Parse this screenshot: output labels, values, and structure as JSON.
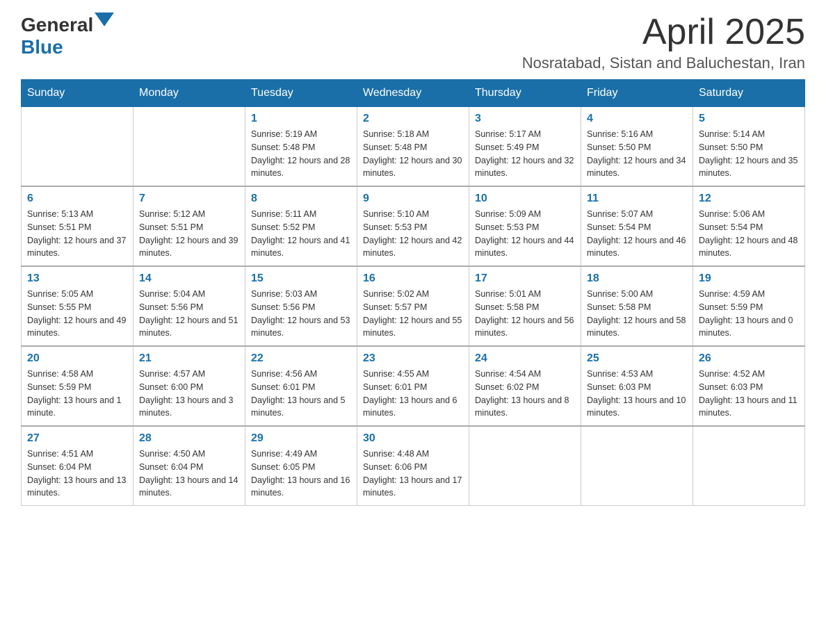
{
  "header": {
    "logo_general": "General",
    "logo_blue": "Blue",
    "month_year": "April 2025",
    "location": "Nosratabad, Sistan and Baluchestan, Iran"
  },
  "days_of_week": [
    "Sunday",
    "Monday",
    "Tuesday",
    "Wednesday",
    "Thursday",
    "Friday",
    "Saturday"
  ],
  "weeks": [
    [
      {
        "day": "",
        "sunrise": "",
        "sunset": "",
        "daylight": ""
      },
      {
        "day": "",
        "sunrise": "",
        "sunset": "",
        "daylight": ""
      },
      {
        "day": "1",
        "sunrise": "Sunrise: 5:19 AM",
        "sunset": "Sunset: 5:48 PM",
        "daylight": "Daylight: 12 hours and 28 minutes."
      },
      {
        "day": "2",
        "sunrise": "Sunrise: 5:18 AM",
        "sunset": "Sunset: 5:48 PM",
        "daylight": "Daylight: 12 hours and 30 minutes."
      },
      {
        "day": "3",
        "sunrise": "Sunrise: 5:17 AM",
        "sunset": "Sunset: 5:49 PM",
        "daylight": "Daylight: 12 hours and 32 minutes."
      },
      {
        "day": "4",
        "sunrise": "Sunrise: 5:16 AM",
        "sunset": "Sunset: 5:50 PM",
        "daylight": "Daylight: 12 hours and 34 minutes."
      },
      {
        "day": "5",
        "sunrise": "Sunrise: 5:14 AM",
        "sunset": "Sunset: 5:50 PM",
        "daylight": "Daylight: 12 hours and 35 minutes."
      }
    ],
    [
      {
        "day": "6",
        "sunrise": "Sunrise: 5:13 AM",
        "sunset": "Sunset: 5:51 PM",
        "daylight": "Daylight: 12 hours and 37 minutes."
      },
      {
        "day": "7",
        "sunrise": "Sunrise: 5:12 AM",
        "sunset": "Sunset: 5:51 PM",
        "daylight": "Daylight: 12 hours and 39 minutes."
      },
      {
        "day": "8",
        "sunrise": "Sunrise: 5:11 AM",
        "sunset": "Sunset: 5:52 PM",
        "daylight": "Daylight: 12 hours and 41 minutes."
      },
      {
        "day": "9",
        "sunrise": "Sunrise: 5:10 AM",
        "sunset": "Sunset: 5:53 PM",
        "daylight": "Daylight: 12 hours and 42 minutes."
      },
      {
        "day": "10",
        "sunrise": "Sunrise: 5:09 AM",
        "sunset": "Sunset: 5:53 PM",
        "daylight": "Daylight: 12 hours and 44 minutes."
      },
      {
        "day": "11",
        "sunrise": "Sunrise: 5:07 AM",
        "sunset": "Sunset: 5:54 PM",
        "daylight": "Daylight: 12 hours and 46 minutes."
      },
      {
        "day": "12",
        "sunrise": "Sunrise: 5:06 AM",
        "sunset": "Sunset: 5:54 PM",
        "daylight": "Daylight: 12 hours and 48 minutes."
      }
    ],
    [
      {
        "day": "13",
        "sunrise": "Sunrise: 5:05 AM",
        "sunset": "Sunset: 5:55 PM",
        "daylight": "Daylight: 12 hours and 49 minutes."
      },
      {
        "day": "14",
        "sunrise": "Sunrise: 5:04 AM",
        "sunset": "Sunset: 5:56 PM",
        "daylight": "Daylight: 12 hours and 51 minutes."
      },
      {
        "day": "15",
        "sunrise": "Sunrise: 5:03 AM",
        "sunset": "Sunset: 5:56 PM",
        "daylight": "Daylight: 12 hours and 53 minutes."
      },
      {
        "day": "16",
        "sunrise": "Sunrise: 5:02 AM",
        "sunset": "Sunset: 5:57 PM",
        "daylight": "Daylight: 12 hours and 55 minutes."
      },
      {
        "day": "17",
        "sunrise": "Sunrise: 5:01 AM",
        "sunset": "Sunset: 5:58 PM",
        "daylight": "Daylight: 12 hours and 56 minutes."
      },
      {
        "day": "18",
        "sunrise": "Sunrise: 5:00 AM",
        "sunset": "Sunset: 5:58 PM",
        "daylight": "Daylight: 12 hours and 58 minutes."
      },
      {
        "day": "19",
        "sunrise": "Sunrise: 4:59 AM",
        "sunset": "Sunset: 5:59 PM",
        "daylight": "Daylight: 13 hours and 0 minutes."
      }
    ],
    [
      {
        "day": "20",
        "sunrise": "Sunrise: 4:58 AM",
        "sunset": "Sunset: 5:59 PM",
        "daylight": "Daylight: 13 hours and 1 minute."
      },
      {
        "day": "21",
        "sunrise": "Sunrise: 4:57 AM",
        "sunset": "Sunset: 6:00 PM",
        "daylight": "Daylight: 13 hours and 3 minutes."
      },
      {
        "day": "22",
        "sunrise": "Sunrise: 4:56 AM",
        "sunset": "Sunset: 6:01 PM",
        "daylight": "Daylight: 13 hours and 5 minutes."
      },
      {
        "day": "23",
        "sunrise": "Sunrise: 4:55 AM",
        "sunset": "Sunset: 6:01 PM",
        "daylight": "Daylight: 13 hours and 6 minutes."
      },
      {
        "day": "24",
        "sunrise": "Sunrise: 4:54 AM",
        "sunset": "Sunset: 6:02 PM",
        "daylight": "Daylight: 13 hours and 8 minutes."
      },
      {
        "day": "25",
        "sunrise": "Sunrise: 4:53 AM",
        "sunset": "Sunset: 6:03 PM",
        "daylight": "Daylight: 13 hours and 10 minutes."
      },
      {
        "day": "26",
        "sunrise": "Sunrise: 4:52 AM",
        "sunset": "Sunset: 6:03 PM",
        "daylight": "Daylight: 13 hours and 11 minutes."
      }
    ],
    [
      {
        "day": "27",
        "sunrise": "Sunrise: 4:51 AM",
        "sunset": "Sunset: 6:04 PM",
        "daylight": "Daylight: 13 hours and 13 minutes."
      },
      {
        "day": "28",
        "sunrise": "Sunrise: 4:50 AM",
        "sunset": "Sunset: 6:04 PM",
        "daylight": "Daylight: 13 hours and 14 minutes."
      },
      {
        "day": "29",
        "sunrise": "Sunrise: 4:49 AM",
        "sunset": "Sunset: 6:05 PM",
        "daylight": "Daylight: 13 hours and 16 minutes."
      },
      {
        "day": "30",
        "sunrise": "Sunrise: 4:48 AM",
        "sunset": "Sunset: 6:06 PM",
        "daylight": "Daylight: 13 hours and 17 minutes."
      },
      {
        "day": "",
        "sunrise": "",
        "sunset": "",
        "daylight": ""
      },
      {
        "day": "",
        "sunrise": "",
        "sunset": "",
        "daylight": ""
      },
      {
        "day": "",
        "sunrise": "",
        "sunset": "",
        "daylight": ""
      }
    ]
  ]
}
